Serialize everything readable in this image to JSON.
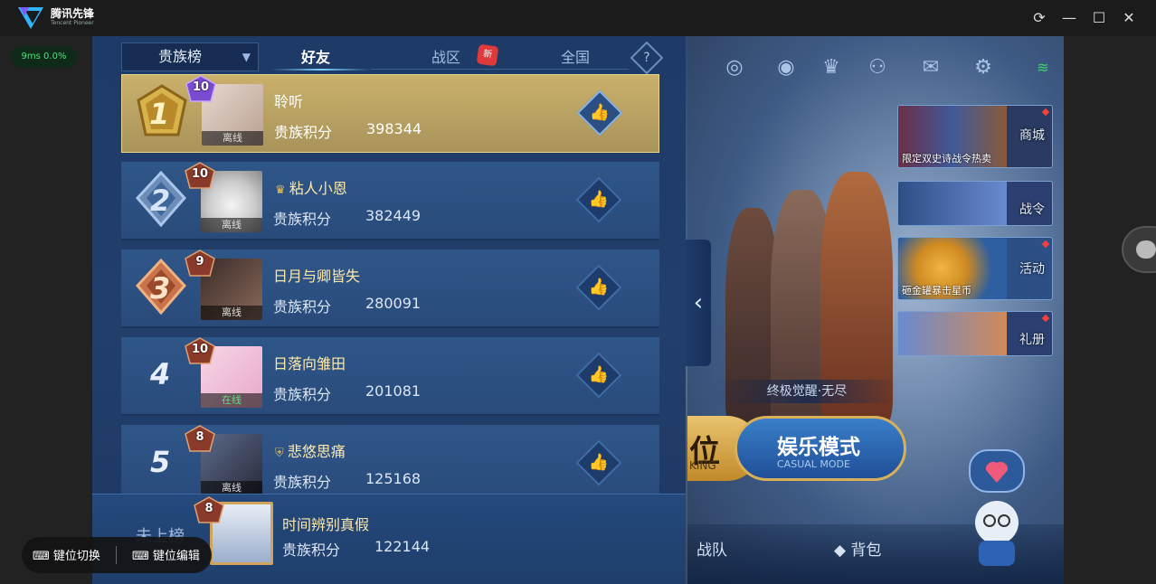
{
  "app": {
    "name": "腾讯先锋",
    "subname": "Tencent Pioneer",
    "ping": "9ms  0.0%"
  },
  "window_buttons": [
    "refresh",
    "minimize",
    "maximize",
    "close"
  ],
  "leaderboard": {
    "selector": "贵族榜",
    "tabs": [
      {
        "label": "好友",
        "active": true
      },
      {
        "label": "战区",
        "badge": "新"
      },
      {
        "label": "全国"
      }
    ],
    "rows": [
      {
        "rank": "1",
        "level": "10",
        "name": "聆听",
        "status": "离线",
        "score_label": "贵族积分",
        "score": "398344"
      },
      {
        "rank": "2",
        "level": "10",
        "name": "粘人小恩",
        "status": "离线",
        "score_label": "贵族积分",
        "score": "382449"
      },
      {
        "rank": "3",
        "level": "9",
        "name": "日月与卿皆失",
        "status": "离线",
        "score_label": "贵族积分",
        "score": "280091"
      },
      {
        "rank": "4",
        "level": "10",
        "name": "日落向雏田",
        "status": "在线",
        "score_label": "贵族积分",
        "score": "201081"
      },
      {
        "rank": "5",
        "level": "8",
        "name": "悲悠思痛",
        "status": "离线",
        "score_label": "贵族积分",
        "score": "125168"
      }
    ],
    "me": {
      "rank": "未上榜",
      "level": "8",
      "name": "时间辨别真假",
      "score_label": "贵族积分",
      "score": "122144"
    }
  },
  "game": {
    "tiles": [
      {
        "caption": "限定双史诗战令热卖",
        "label": "商城"
      },
      {
        "caption": "",
        "label": "战令"
      },
      {
        "caption": "砸金罐暴击星币",
        "label": "活动"
      },
      {
        "caption": "",
        "label": "礼册"
      }
    ],
    "rank_tag": "终极觉醒·无尽",
    "rank_btn": {
      "t1": "位",
      "t2": "KING"
    },
    "mode_btn": {
      "t1": "娱乐模式",
      "t2": "CASUAL MODE"
    },
    "bottom_nav": [
      "战队",
      "背包"
    ]
  },
  "keybar": {
    "switch": "键位切换",
    "edit": "键位编辑"
  },
  "colors": {
    "accent_gold": "#c9b06b",
    "panel_blue": "#223f6c",
    "online_green": "#5de07f"
  }
}
